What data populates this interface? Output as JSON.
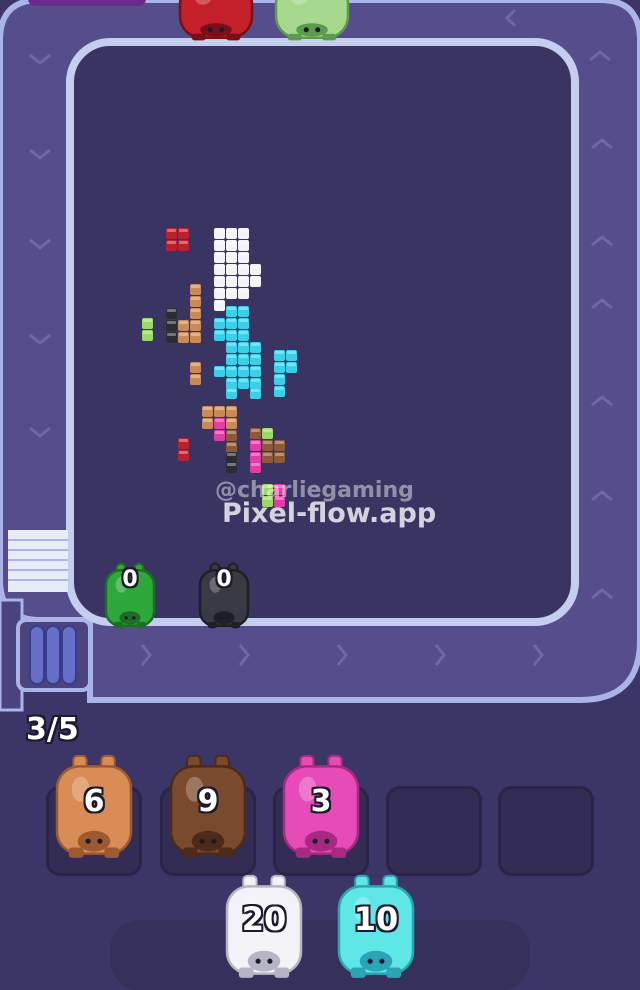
{
  "watermark": {
    "handle": "@charliegaming",
    "site": "Pixel-flow.app"
  },
  "tray": {
    "counter": "3/5"
  },
  "active_pigs": [
    {
      "color": "#2ea83a",
      "dark": "#1b6e22",
      "ammo": "0",
      "name": "green"
    },
    {
      "color": "#3a3a44",
      "dark": "#1f1f26",
      "ammo": "0",
      "name": "black"
    }
  ],
  "top_pigs": [
    {
      "color": "#c4202a",
      "name": "red"
    },
    {
      "color": "#a6d98e",
      "name": "lightgreen"
    }
  ],
  "slots": [
    {
      "color": "#d98c55",
      "dark": "#9d5a30",
      "ammo": "6",
      "name": "tan"
    },
    {
      "color": "#7a4a2c",
      "dark": "#4c2c18",
      "ammo": "9",
      "name": "brown"
    },
    {
      "color": "#e64bb8",
      "dark": "#a82a80",
      "ammo": "3",
      "name": "pink"
    },
    {
      "color": null,
      "ammo": null,
      "name": "empty"
    },
    {
      "color": null,
      "ammo": null,
      "name": "empty"
    }
  ],
  "queue": [
    {
      "color": "#f2f2f7",
      "dark": "#b5b5c4",
      "ammo": "20",
      "name": "white"
    },
    {
      "color": "#5fe6e6",
      "dark": "#2aa5b5",
      "ammo": "10",
      "name": "cyan"
    }
  ],
  "pixel_colors": {
    "W": "#f4f4f8",
    "C": "#3ccfe8",
    "B": "#8c5a3a",
    "T": "#c98a5a",
    "R": "#b8222e",
    "P": "#e23ca8",
    "G": "#9ad86a",
    "K": "#2c2c34"
  }
}
